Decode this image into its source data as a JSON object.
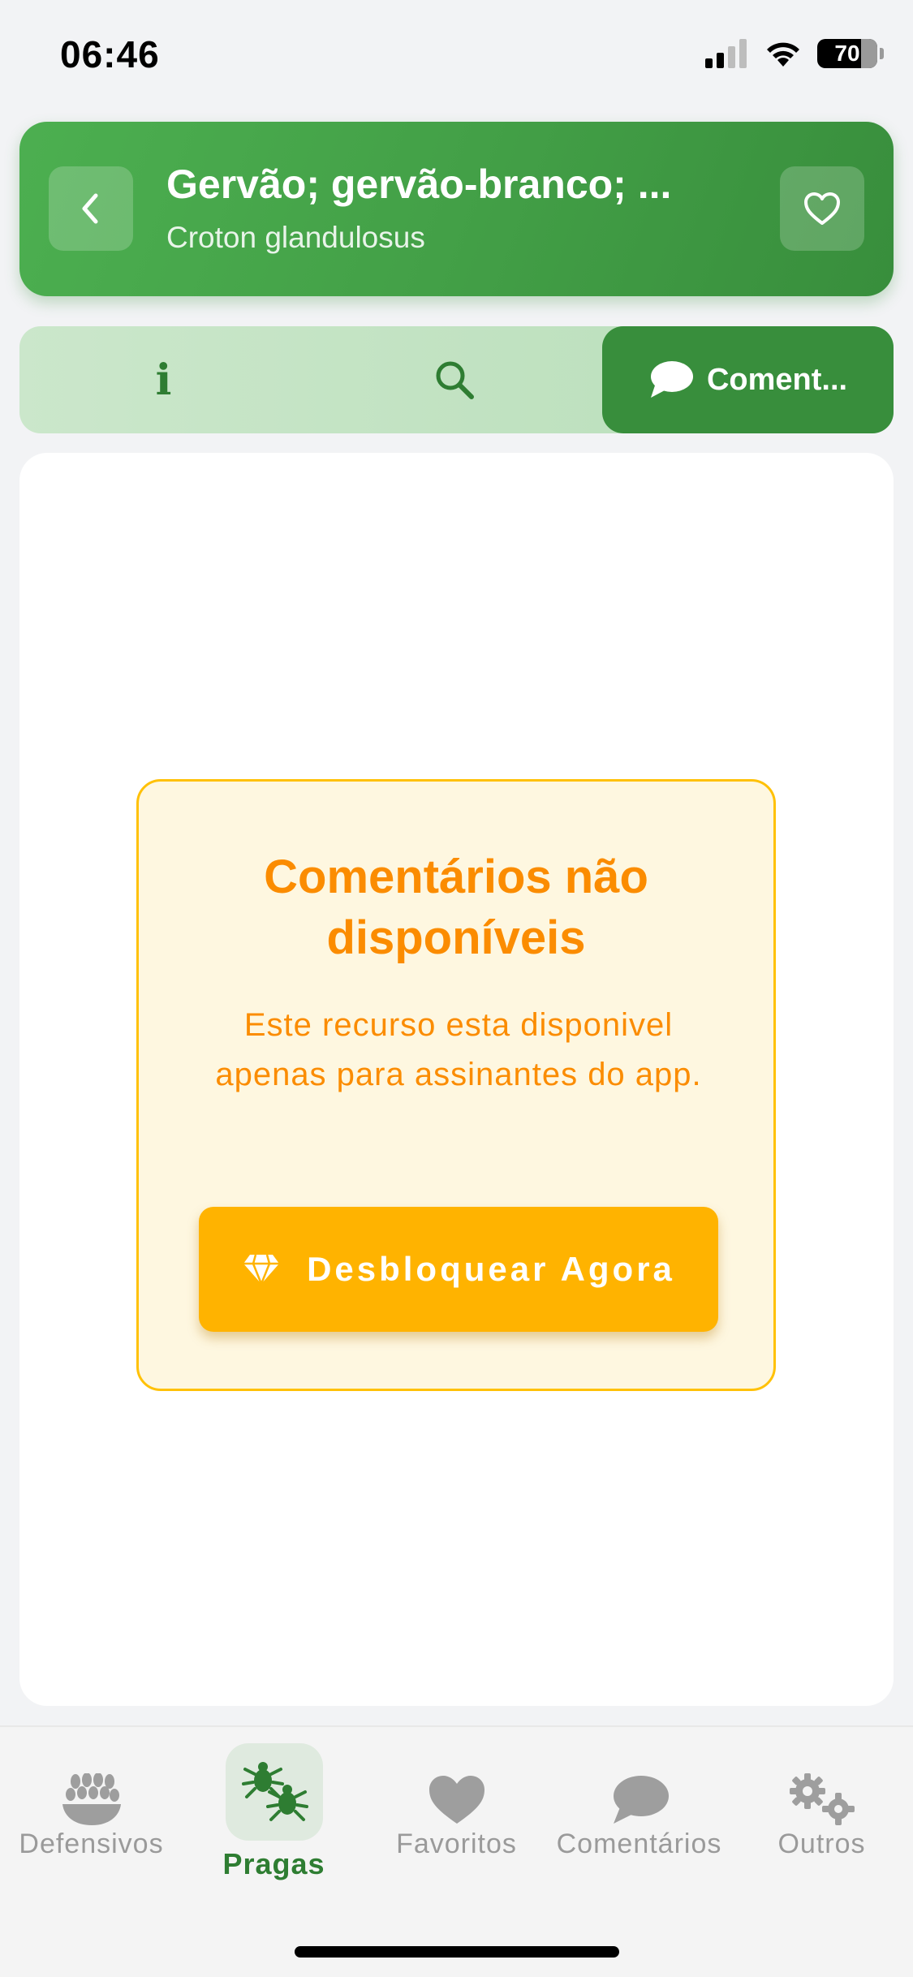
{
  "status_bar": {
    "time": "06:46",
    "battery": "70"
  },
  "header": {
    "title": "Gervão; gervão-branco; ...",
    "subtitle": "Croton glandulosus",
    "accent_color": "#43a047"
  },
  "tabs": [
    {
      "name": "info",
      "icon": "info-icon",
      "label": ""
    },
    {
      "name": "search",
      "icon": "search-icon",
      "label": ""
    },
    {
      "name": "comments",
      "icon": "chat-bubble-icon",
      "label": "Coment...",
      "active": true
    }
  ],
  "notice": {
    "title": "Comentários não disponíveis",
    "description": "Este recurso esta disponivel apenas para assinantes do app.",
    "button_label": "Desbloquear Agora",
    "button_icon": "diamond-icon"
  },
  "bottom_nav": {
    "items": [
      {
        "label": "Defensivos",
        "icon": "bowl-icon"
      },
      {
        "label": "Pragas",
        "icon": "bugs-icon",
        "active": true
      },
      {
        "label": "Favoritos",
        "icon": "heart-icon"
      },
      {
        "label": "Comentários",
        "icon": "chat-bubble-icon"
      },
      {
        "label": "Outros",
        "icon": "gears-icon"
      }
    ]
  }
}
